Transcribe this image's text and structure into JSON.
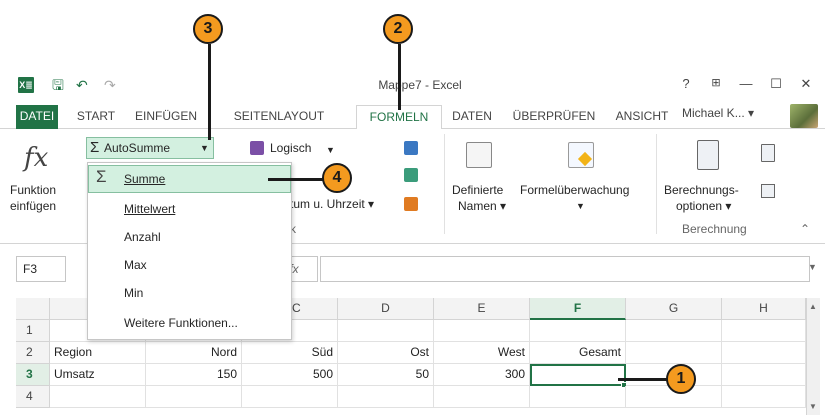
{
  "window": {
    "title": "Mappe7 - Excel",
    "help": "?",
    "minimize": "—",
    "maximize": "☐",
    "close": "✕"
  },
  "qat": {
    "logo": "X≣",
    "save": "🖫",
    "undo": "↶",
    "redo": "↷"
  },
  "tabs": [
    "DATEI",
    "START",
    "EINFÜGEN",
    "SEITENLAYOUT",
    "FORMELN",
    "DATEN",
    "ÜBERPRÜFEN",
    "ANSICHT"
  ],
  "account": "Michael K... ▾",
  "ribbon": {
    "fx_symbol": "fx",
    "funktion_line1": "Funktion",
    "funktion_line2": "einfügen",
    "autosumme": "AutoSumme",
    "logisch": "Logisch",
    "datum": "tum u. Uhrzeit ▾",
    "definierte_namen_line1": "Definierte",
    "definierte_namen_line2": "Namen ▾",
    "formelueberwachung": "Formelüberwachung",
    "berechnungs_line1": "Berechnungs-",
    "berechnungs_line2": "optionen ▾",
    "berechnung_group": "Berechnung"
  },
  "menu": {
    "items": [
      "Summe",
      "Mittelwert",
      "Anzahl",
      "Max",
      "Min",
      "Weitere Funktionen..."
    ]
  },
  "formula_bar": {
    "namebox": "F3",
    "fx": "fx",
    "value": ""
  },
  "columns": [
    "C",
    "D",
    "E",
    "F",
    "G",
    "H"
  ],
  "rows": [
    "1",
    "2",
    "3",
    "4"
  ],
  "table": {
    "row2": [
      "Region",
      "Nord",
      "Süd",
      "Ost",
      "West",
      "Gesamt"
    ],
    "row3": [
      "Umsatz",
      "150",
      "500",
      "50",
      "300",
      ""
    ]
  },
  "callouts": [
    "1",
    "2",
    "3",
    "4"
  ],
  "colors": {
    "excel_green": "#217346",
    "callout_orange": "#f49a1f",
    "selection_green": "#d3f0e0"
  }
}
